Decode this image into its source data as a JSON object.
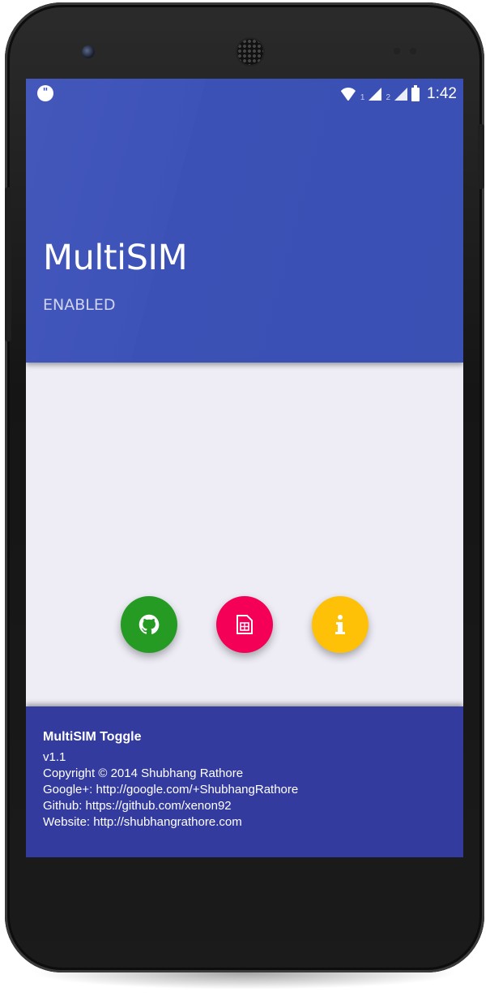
{
  "status_bar": {
    "notification_icon": "hangouts-icon",
    "sim1_label": "1",
    "sim2_label": "2",
    "time": "1:42"
  },
  "header": {
    "title": "MultiSIM",
    "state": "ENABLED",
    "color": "#3c51b5"
  },
  "actions": [
    {
      "icon": "github-icon",
      "color": "#259b24"
    },
    {
      "icon": "sim-card-icon",
      "color": "#f50057"
    },
    {
      "icon": "info-icon",
      "color": "#ffc107"
    }
  ],
  "footer": {
    "title": "MultiSIM Toggle",
    "version": "v1.1",
    "copyright": "Copyright © 2014 Shubhang Rathore",
    "google_plus": "Google+: http://google.com/+ShubhangRathore",
    "github": "Github: https://github.com/xenon92",
    "website": "Website: http://shubhangrathore.com",
    "color": "#343b9f"
  }
}
